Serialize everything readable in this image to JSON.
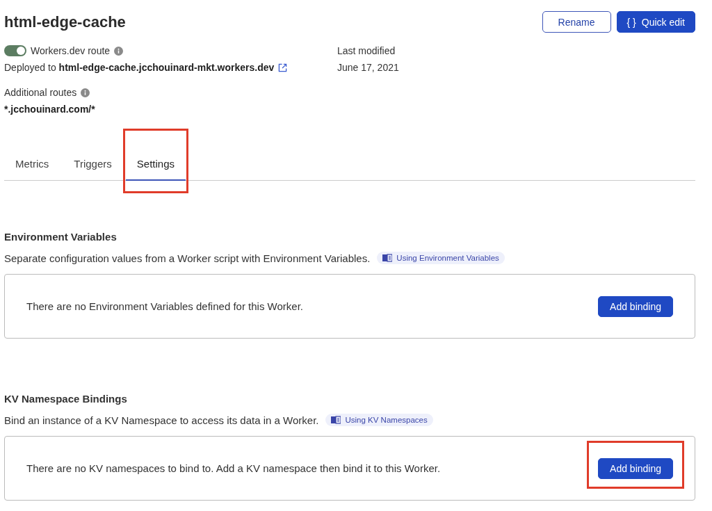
{
  "header": {
    "title": "html-edge-cache",
    "buttons": [
      {
        "kind": "outline",
        "label": "Rename"
      },
      {
        "kind": "primary",
        "icon_text": "{ }",
        "label": "Quick edit"
      }
    ]
  },
  "details": {
    "route_toggle": {
      "label": "Workers.dev route",
      "on": true
    },
    "deployed_prefix": "Deployed to ",
    "deployed_host": "html-edge-cache.jcchouinard-mkt.workers.dev",
    "additional_routes_label": "Additional routes",
    "additional_route": "*.jcchouinard.com/*",
    "last_modified_label": "Last modified",
    "last_modified_value": "June 17, 2021"
  },
  "tabs": [
    {
      "label": "Metrics",
      "selected": false,
      "highlighted": false
    },
    {
      "label": "Triggers",
      "selected": false,
      "highlighted": false
    },
    {
      "label": "Settings",
      "selected": true,
      "highlighted": true
    }
  ],
  "sections": [
    {
      "title": "Environment Variables",
      "description": "Separate configuration values from a Worker script with Environment Variables.",
      "doc_link": "Using Environment Variables",
      "empty_message": "There are no Environment Variables defined for this Worker.",
      "button": "Add binding",
      "highlighted": false
    },
    {
      "title": "KV Namespace Bindings",
      "description": "Bind an instance of a KV Namespace to access its data in a Worker.",
      "doc_link": "Using KV Namespaces",
      "empty_message": "There are no KV namespaces to bind to. Add a KV namespace then bind it to this Worker.",
      "button": "Add binding",
      "highlighted": true
    }
  ]
}
